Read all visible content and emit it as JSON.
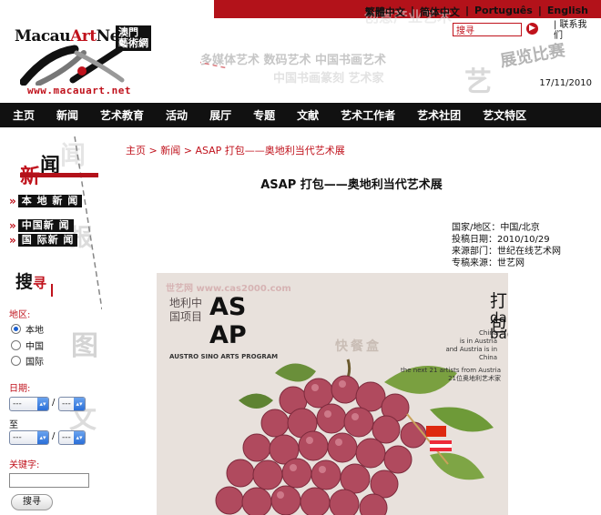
{
  "header": {
    "languages": [
      "繁體中文",
      "简体中文",
      "Português",
      "English"
    ],
    "logo_text_a": "Macau",
    "logo_text_b": "Art",
    "logo_text_c": "Net",
    "logo_cn_1": "澳門",
    "logo_cn_2": "藝術網",
    "logo_url": "www.macauart.net",
    "search_value": "搜寻",
    "contact_label": "| 联系我们",
    "date": "17/11/2010",
    "deco_1": "创意产业",
    "deco_2": "多媒体艺术",
    "deco_3": "展览比赛"
  },
  "nav": {
    "items": [
      "主页",
      "新闻",
      "艺术教育",
      "活动",
      "展厅",
      "专题",
      "文献",
      "艺术工作者",
      "艺术社团",
      "艺文特区"
    ]
  },
  "sidebar": {
    "news_title_a": "新",
    "news_title_b": "闻",
    "news_links": [
      "本 地 新 闻",
      "中国新 闻",
      "国 际新 闻"
    ],
    "search_title_a": "搜",
    "search_title_b": "寻",
    "region_label": "地区:",
    "regions": [
      "本地",
      "中国",
      "国际"
    ],
    "date_label": "日期:",
    "select_placeholder": "---",
    "to_label": "至",
    "slash": "/",
    "keyword_label": "关键字:",
    "search_button": "搜寻"
  },
  "main": {
    "breadcrumb": [
      "主页",
      "新闻",
      "ASAP 打包——奥地利当代艺术展"
    ],
    "breadcrumb_sep": " > ",
    "title": "ASAP 打包——奥地利当代艺术展",
    "meta": [
      "国家/地区：中国/北京",
      " 投稿日期：2010/10/29",
      "来源部门：世纪在线艺术网",
      " 专稿来源：世艺网"
    ]
  },
  "poster": {
    "watermark": "世艺网 www.cas2000.com",
    "cn_title": "地利中国项目",
    "asap": "AS AP",
    "program": "AUSTRO SINO ARTS PROGRAM",
    "center_cn": "快餐盒",
    "dabao_cn": "打包",
    "dabao": "da bao",
    "china_lines": [
      "China",
      "is in Austria",
      "and Austria is in",
      "China"
    ],
    "next_line": "the next 21 artists from Austria",
    "next_line_cn": "21位奥地利艺术家"
  },
  "colors": {
    "brand_red": "#b3121a",
    "nav_bg": "#111111",
    "link_red": "#c0121c"
  },
  "icons": {
    "search_go": "arrow-right-circle-icon",
    "side_arrow": "double-chevron-right-icon"
  }
}
